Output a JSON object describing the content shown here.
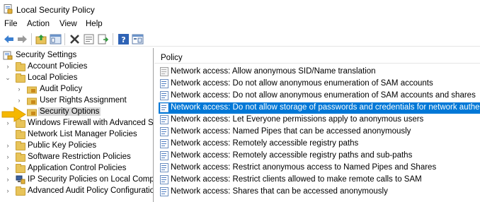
{
  "window": {
    "title": "Local Security Policy"
  },
  "menu": [
    "File",
    "Action",
    "View",
    "Help"
  ],
  "toolbar": {
    "buttons": [
      "back-icon",
      "forward-icon",
      "up-folder-icon",
      "show-hide-tree-icon",
      "delete-icon",
      "properties-icon",
      "export-list-icon",
      "help-icon",
      "console-icon"
    ]
  },
  "tree": {
    "items": [
      {
        "label": "Security Settings",
        "level": 0,
        "expander": "",
        "icon": "security-settings-icon"
      },
      {
        "label": "Account Policies",
        "level": 1,
        "expander": ">",
        "icon": "folder-icon"
      },
      {
        "label": "Local Policies",
        "level": 1,
        "expander": "v",
        "icon": "folder-icon"
      },
      {
        "label": "Audit Policy",
        "level": 2,
        "expander": ">",
        "icon": "lock-folder-icon"
      },
      {
        "label": "User Rights Assignment",
        "level": 2,
        "expander": ">",
        "icon": "lock-folder-icon"
      },
      {
        "label": "Security Options",
        "level": 2,
        "expander": "",
        "icon": "lock-folder-icon",
        "selected": true
      },
      {
        "label": "Windows Firewall with Advanced Secu",
        "level": 1,
        "expander": ">",
        "icon": "folder-icon"
      },
      {
        "label": "Network List Manager Policies",
        "level": 1,
        "expander": "",
        "icon": "folder-icon"
      },
      {
        "label": "Public Key Policies",
        "level": 1,
        "expander": ">",
        "icon": "folder-icon"
      },
      {
        "label": "Software Restriction Policies",
        "level": 1,
        "expander": ">",
        "icon": "folder-icon"
      },
      {
        "label": "Application Control Policies",
        "level": 1,
        "expander": ">",
        "icon": "folder-icon"
      },
      {
        "label": "IP Security Policies on Local Compute",
        "level": 1,
        "expander": ">",
        "icon": "ip-security-icon"
      },
      {
        "label": "Advanced Audit Policy Configuration",
        "level": 1,
        "expander": ">",
        "icon": "folder-icon"
      }
    ]
  },
  "list": {
    "column_header": "Policy",
    "rows": [
      {
        "label": "Network access: Allow anonymous SID/Name translation",
        "icon": "policy-disabled-icon"
      },
      {
        "label": "Network access: Do not allow anonymous enumeration of SAM accounts",
        "icon": "policy-icon"
      },
      {
        "label": "Network access: Do not allow anonymous enumeration of SAM accounts and shares",
        "icon": "policy-icon"
      },
      {
        "label": "Network access: Do not allow storage of passwords and credentials for network authentication",
        "icon": "policy-icon",
        "selected": true
      },
      {
        "label": "Network access: Let Everyone permissions apply to anonymous users",
        "icon": "policy-icon"
      },
      {
        "label": "Network access: Named Pipes that can be accessed anonymously",
        "icon": "policy-icon"
      },
      {
        "label": "Network access: Remotely accessible registry paths",
        "icon": "policy-icon"
      },
      {
        "label": "Network access: Remotely accessible registry paths and sub-paths",
        "icon": "policy-icon"
      },
      {
        "label": "Network access: Restrict anonymous access to Named Pipes and Shares",
        "icon": "policy-icon"
      },
      {
        "label": "Network access: Restrict clients allowed to make remote calls to SAM",
        "icon": "policy-icon"
      },
      {
        "label": "Network access: Shares that can be accessed anonymously",
        "icon": "policy-icon"
      }
    ]
  },
  "colors": {
    "selection": "#0078d7",
    "tree_selection": "#d9d9d9",
    "arrow": "#f5b700"
  }
}
